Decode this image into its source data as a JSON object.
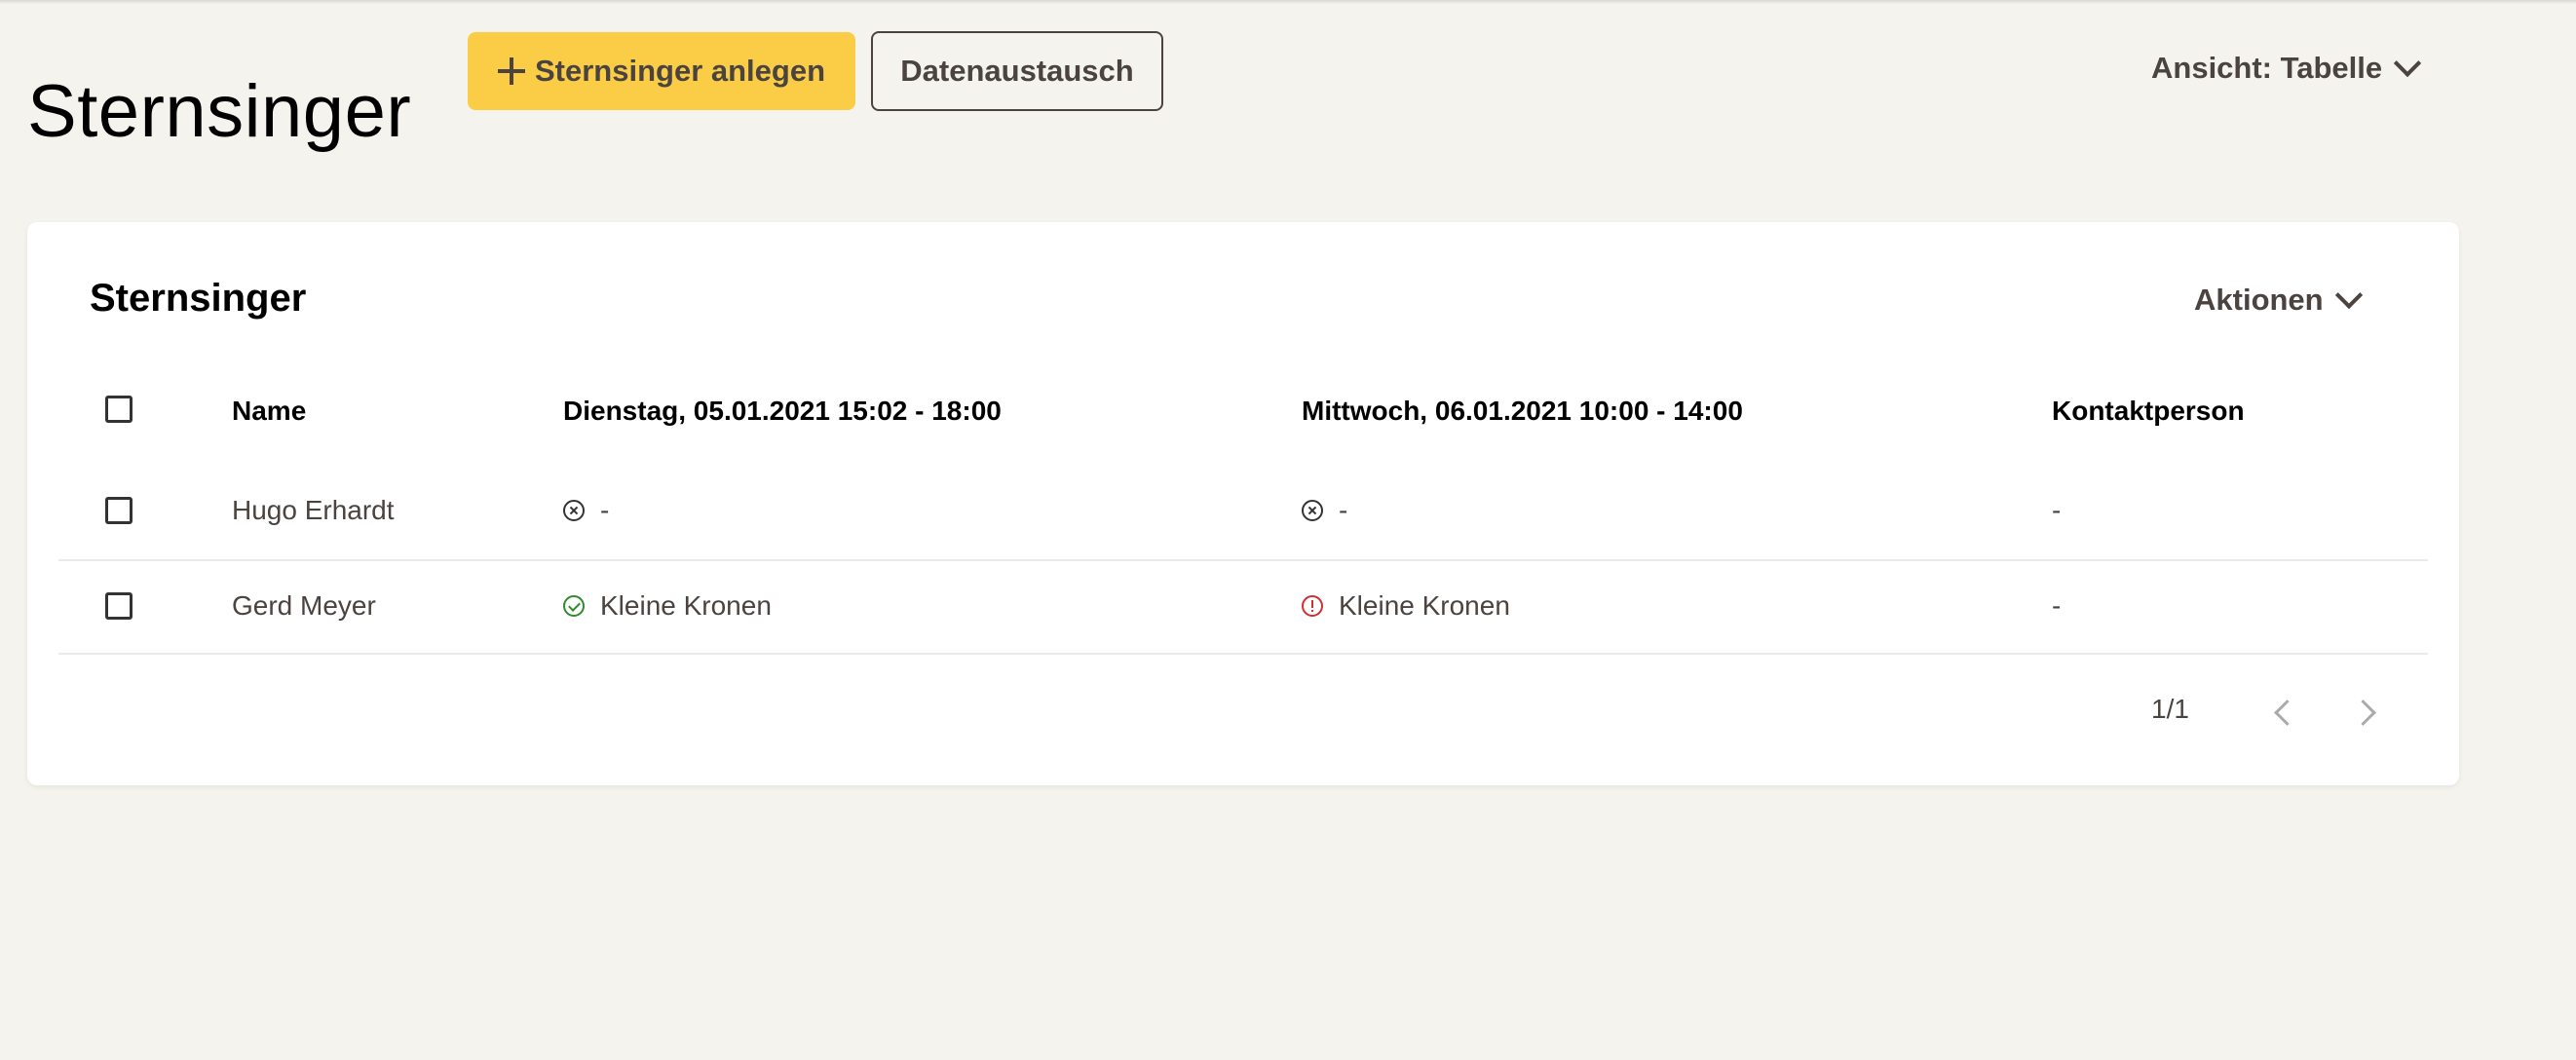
{
  "header": {
    "title": "Sternsinger",
    "create_label": "Sternsinger anlegen",
    "exchange_label": "Datenaustausch",
    "view_label": "Ansicht: Tabelle"
  },
  "card": {
    "title": "Sternsinger",
    "actions_label": "Aktionen"
  },
  "table": {
    "columns": {
      "name": "Name",
      "day1": "Dienstag, 05.01.2021 15:02 - 18:00",
      "day2": "Mittwoch, 06.01.2021 10:00 - 14:00",
      "contact": "Kontaktperson"
    },
    "rows": [
      {
        "name": "Hugo Erhardt",
        "day1": {
          "icon": "x-circle-icon",
          "text": "-"
        },
        "day2": {
          "icon": "x-circle-icon",
          "text": "-"
        },
        "contact": "-"
      },
      {
        "name": "Gerd Meyer",
        "day1": {
          "icon": "check-circle-icon",
          "color": "#2e8b2e",
          "text": "Kleine Kronen"
        },
        "day2": {
          "icon": "alert-circle-icon",
          "color": "#d32f2f",
          "text": "Kleine Kronen"
        },
        "contact": "-"
      }
    ]
  },
  "pagination": {
    "text": "1/1"
  },
  "colors": {
    "primary": "#fbcd47",
    "background": "#f4f3ed"
  }
}
